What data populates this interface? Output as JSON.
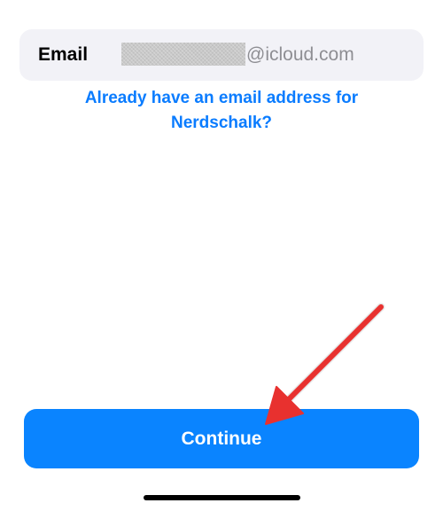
{
  "email_field": {
    "label": "Email",
    "domain_suffix": "@icloud.com"
  },
  "already_have_email_link": {
    "line1": "Already have an email address for",
    "line2": "Nerdschalk?"
  },
  "continue_button": {
    "label": "Continue"
  },
  "colors": {
    "accent": "#0a84ff",
    "link": "#0a7cff",
    "field_background": "#f2f2f7",
    "annotation_arrow": "#e8312f"
  }
}
